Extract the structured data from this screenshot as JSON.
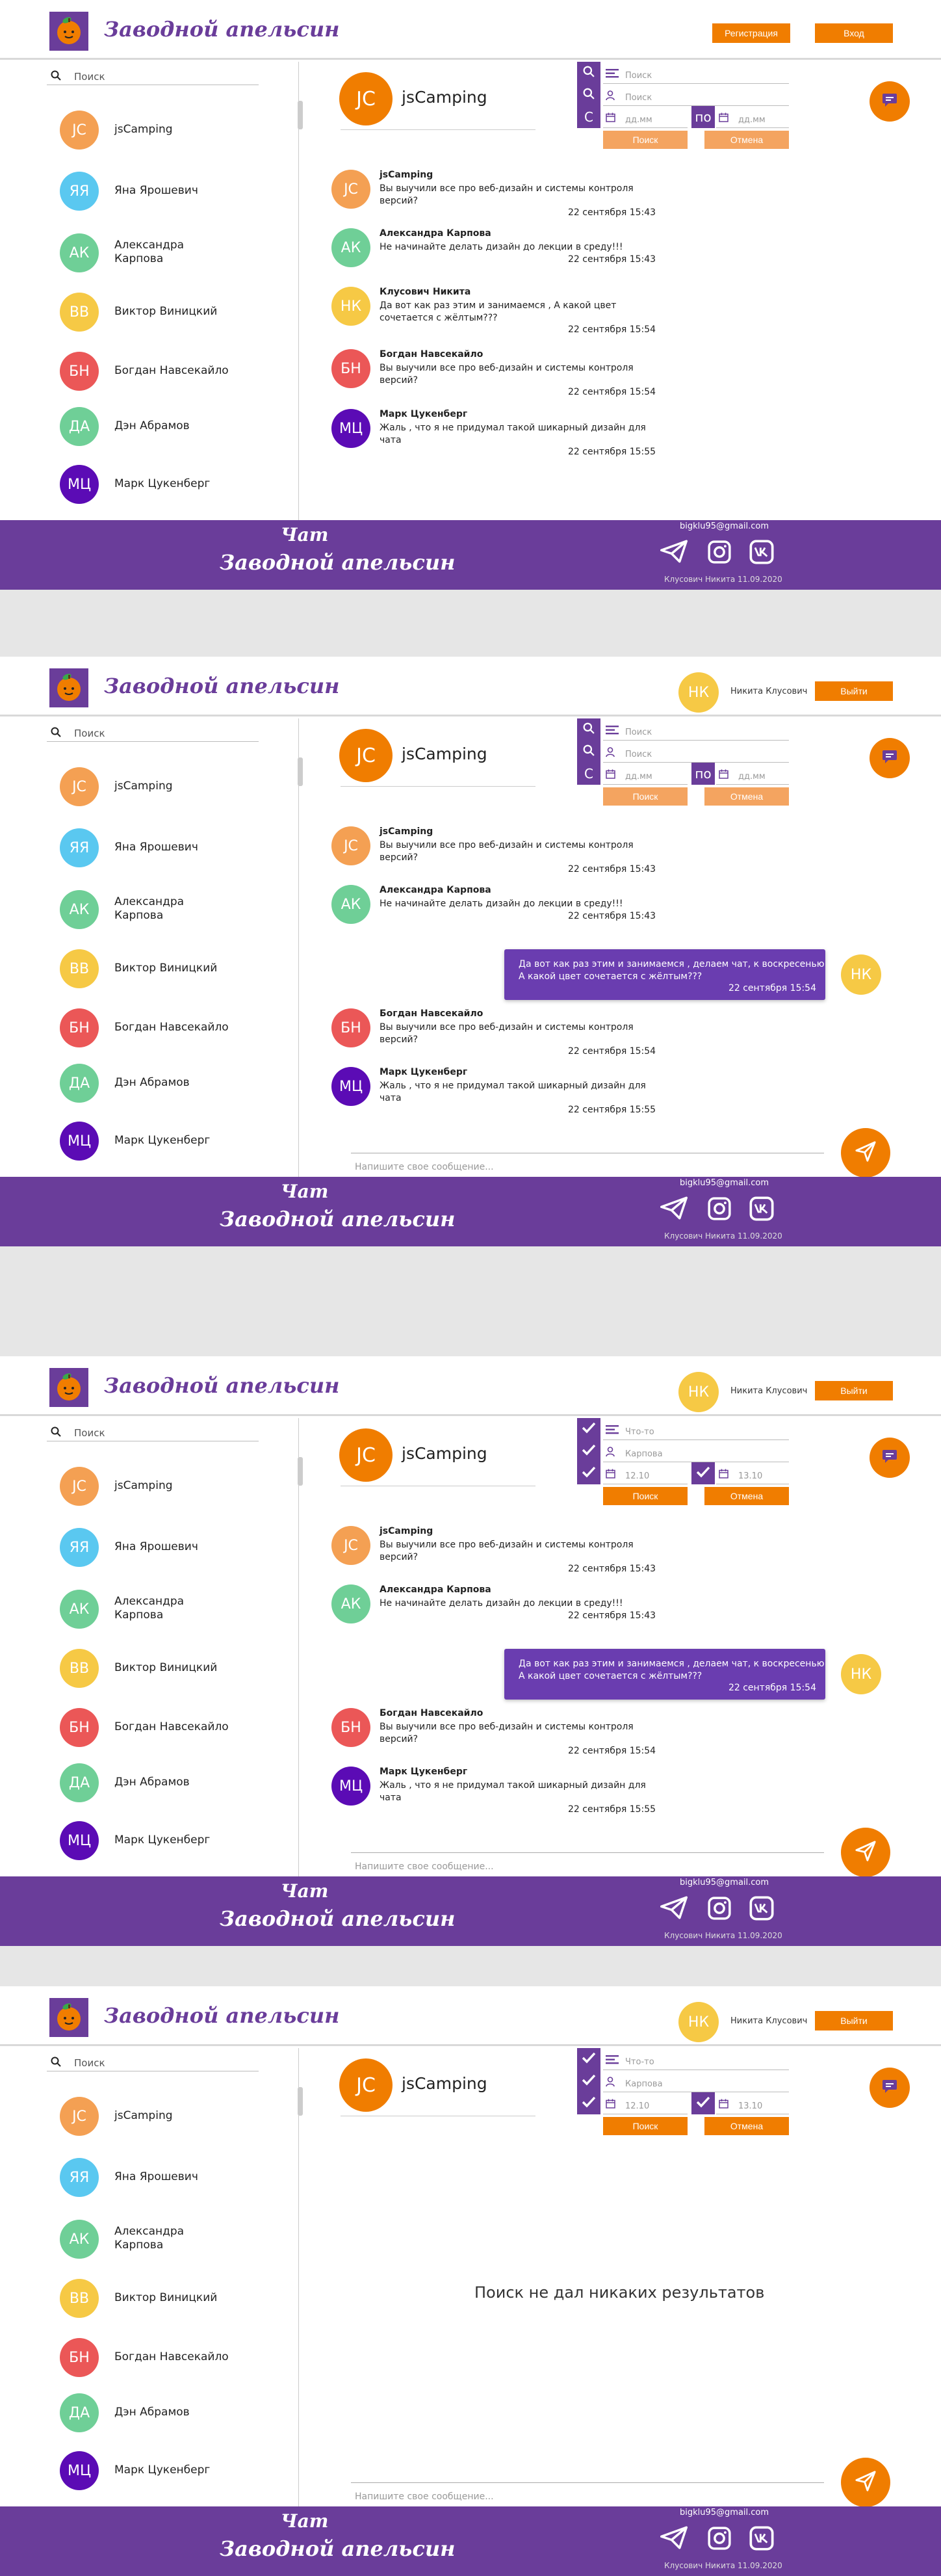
{
  "brand": {
    "name": "Заводной апельсин"
  },
  "auth": {
    "register": "Регистрация",
    "login": "Вход",
    "logout": "Выйти"
  },
  "user": {
    "initials": "НК",
    "name": "Никита Клусович"
  },
  "search": {
    "placeholder": "Поиск"
  },
  "contacts": [
    {
      "initials": "JC",
      "name": "jsCamping",
      "color": "#f4a053"
    },
    {
      "initials": "ЯЯ",
      "name": "Яна Ярошевич",
      "color": "#5ac8f0"
    },
    {
      "initials": "АК",
      "name": "Александра Карпова",
      "color": "#6fcf97"
    },
    {
      "initials": "ВВ",
      "name": "Виктор Виницкий",
      "color": "#f6c945"
    },
    {
      "initials": "БН",
      "name": "Богдан Навсекайло",
      "color": "#eb5757"
    },
    {
      "initials": "ДА",
      "name": "Дэн Абрамов",
      "color": "#6fcf97"
    },
    {
      "initials": "МЦ",
      "name": "Марк Цукенберг",
      "color": "#5b0bb5"
    }
  ],
  "chat": {
    "initials": "JC",
    "title": "jsCamping",
    "avatar_color": "#f07d00"
  },
  "filters": {
    "text_placeholder": "Поиск",
    "author_placeholder": "Поиск",
    "date_from": "дд.мм",
    "date_to": "дд.мм",
    "to_label": "по",
    "search_btn": "Поиск",
    "cancel_btn": "Отмена",
    "q_icon": "search-icon",
    "c_label": "С",
    "filled_text": "Что-то",
    "filled_author": "Карпова",
    "filled_from": "12.10",
    "filled_to": "13.10"
  },
  "messages": [
    {
      "author": "jsCamping",
      "initials": "JC",
      "color": "#f4a053",
      "text": "Вы выучили все про веб-дизайн и системы контроля версий?",
      "time": "22 сентября 15:43"
    },
    {
      "author": "Александра Карпова",
      "initials": "АК",
      "color": "#6fcf97",
      "text": "Не начинайте делать дизайн до лекции в среду!!!",
      "time": "22 сентября 15:43"
    },
    {
      "author": "Клусович Никита",
      "initials": "НК",
      "color": "#f6c945",
      "text": "Да вот как раз этим и занимаемся , А какой цвет сочетается с жёлтым???",
      "time": "22 сентября 15:54"
    },
    {
      "author": "Богдан Навсекайло",
      "initials": "БН",
      "color": "#eb5757",
      "text": "Вы выучили все про веб-дизайн и системы контроля версий?",
      "time": "22 сентября 15:54"
    },
    {
      "author": "Марк Цукенберг",
      "initials": "МЦ",
      "color": "#5b0bb5",
      "text": "Жаль , что я не придумал такой шикарный  дизайн для чата",
      "time": "22 сентября 15:55"
    }
  ],
  "my_message": {
    "initials": "НК",
    "text1": "Да вот как раз этим и занимаемся , делаем чат, к воскресенью",
    "text2": "А какой цвет сочетается с жёлтым???",
    "time": "22 сентября  15:54"
  },
  "composer": {
    "placeholder": "Напишите свое сообщение..."
  },
  "empty": {
    "text": "Поиск не дал никаких результатов"
  },
  "footer": {
    "title1": "Чат",
    "title2": "Заводной апельсин",
    "email": "bigklu95@gmail.com",
    "copy": "Клусович Никита  11.09.2020"
  },
  "colors": {
    "purple": "#6a3d9a",
    "orange": "#f07d00",
    "light_orange": "#f4a460"
  }
}
